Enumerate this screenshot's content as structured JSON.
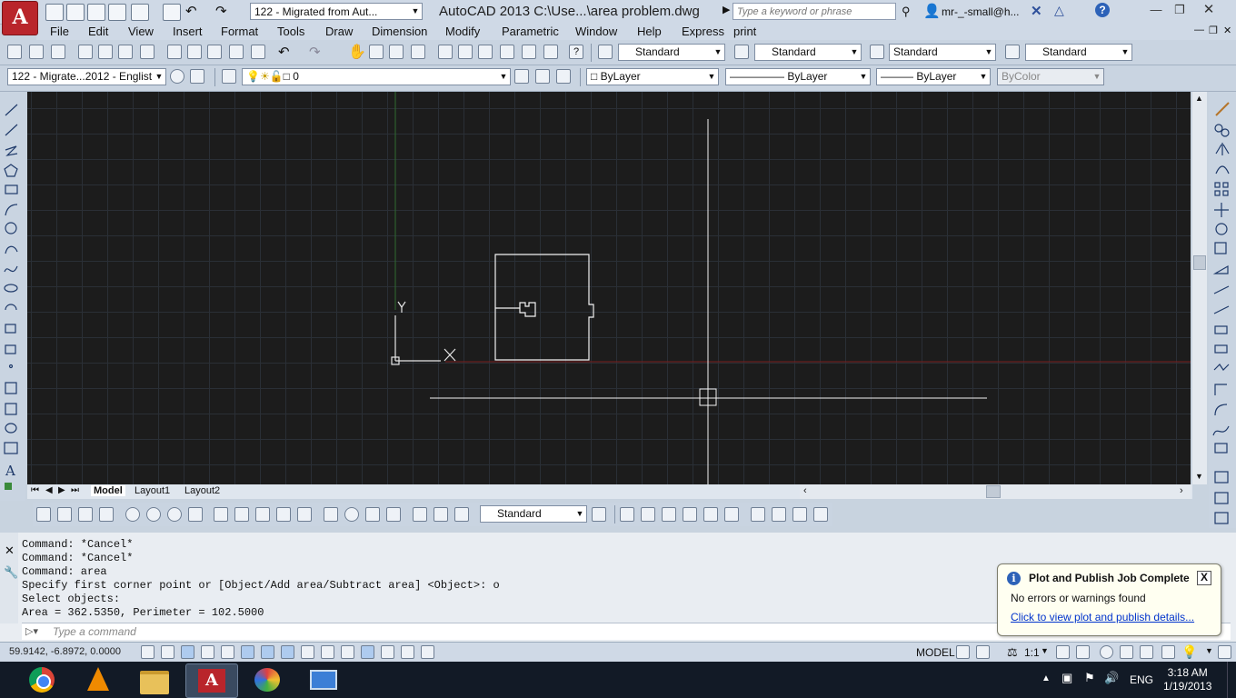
{
  "titlebar": {
    "workspace": "122 - Migrated from Aut...",
    "title": "AutoCAD 2013    C:\\Use...\\area problem.dwg",
    "search_placeholder": "Type a keyword or phrase",
    "user": "mr-_-small@h...",
    "app_icon": "A"
  },
  "menu": [
    "File",
    "Edit",
    "View",
    "Insert",
    "Format",
    "Tools",
    "Draw",
    "Dimension",
    "Modify",
    "Parametric",
    "Window",
    "Help",
    "Express",
    "print"
  ],
  "styles_toolbar": {
    "text_style": "Standard",
    "dim_style": "Standard",
    "table_style": "Standard",
    "mleader_style": "Standard"
  },
  "layers_toolbar": {
    "workspace_short": "122 - Migrate...2012 - Englist",
    "layer": "0",
    "color": "ByLayer",
    "linetype": "ByLayer",
    "lineweight": "ByLayer",
    "plotstyle": "ByColor"
  },
  "canvas": {
    "ucs_y": "Y",
    "ucs_x": "X"
  },
  "layout_tabs": [
    "Model",
    "Layout1",
    "Layout2"
  ],
  "dim_toolbar": {
    "dim_style": "Standard"
  },
  "command": {
    "lines": [
      "Command: *Cancel*",
      "Command: *Cancel*",
      "Command: area",
      "Specify first corner point or [Object/Add area/Subtract area] <Object>: o",
      "Select objects:",
      "Area = 362.5350, Perimeter = 102.5000"
    ],
    "input_placeholder": "Type a command"
  },
  "statusbar": {
    "coords": "59.9142, -6.8972, 0.0000",
    "space": "MODEL",
    "scale": "1:1"
  },
  "notification": {
    "title": "Plot and Publish Job Complete",
    "body": "No errors or warnings found",
    "link": "Click to view plot and publish details...",
    "close": "X",
    "info": "i"
  },
  "taskbar": {
    "lang": "ENG",
    "time": "3:18 AM",
    "date": "1/19/2013"
  }
}
